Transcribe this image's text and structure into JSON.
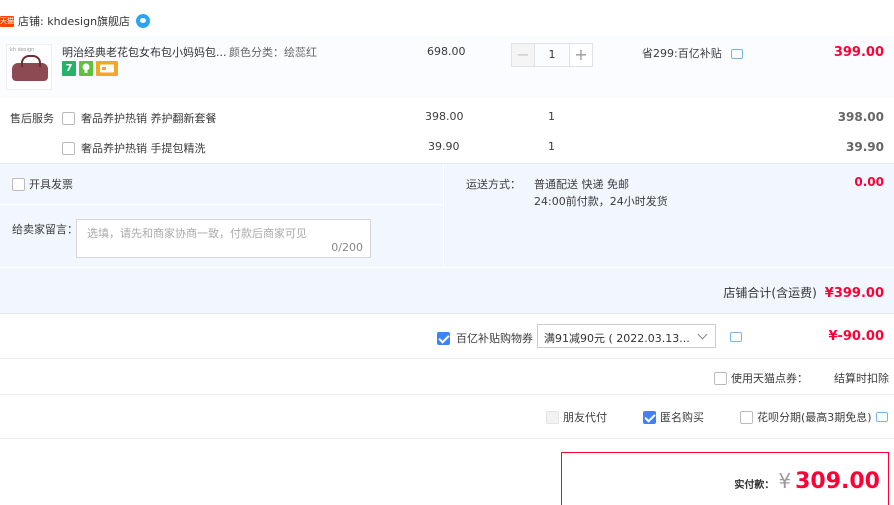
{
  "shop": {
    "tag": "天猫",
    "name": "店铺: khdesign旗舰店"
  },
  "item": {
    "thumb_brand": "kh design",
    "title": "明治经典老花包女布包小妈妈包...",
    "attr": "颜色分类：绘蕊红",
    "unit_price": "698.00",
    "quantity": "1",
    "saving": "省299:百亿补贴",
    "subtotal": "399.00",
    "badges": [
      "7",
      "bulb-icon",
      "card-icon"
    ]
  },
  "services": {
    "label": "售后服务",
    "items": [
      {
        "name": "奢品养护热销 养护翻新套餐",
        "price": "398.00",
        "qty": "1",
        "total": "398.00",
        "checked": false
      },
      {
        "name": "奢品养护热销 手提包精洗",
        "price": "39.90",
        "qty": "1",
        "total": "39.90",
        "checked": false
      }
    ]
  },
  "invoice": {
    "label": "开具发票",
    "checked": false
  },
  "shipping": {
    "label": "运送方式：",
    "method": "普通配送 快递 免邮",
    "detail": "24:00前付款，24小时发货",
    "fee": "0.00"
  },
  "memo": {
    "label": "给卖家留言：",
    "placeholder": "选填，请先和商家协商一致，付款后商家可见",
    "counter": "0/200"
  },
  "shop_total": {
    "label": "店铺合计(含运费)",
    "value": "¥399.00"
  },
  "coupon": {
    "label": "百亿补贴购物券",
    "checked": true,
    "selected": "满91减90元 ( 2022.03.13...",
    "discount": "¥-90.00"
  },
  "tmall_points": {
    "label": "使用天猫点券：",
    "note": "结算时扣除",
    "checked": false
  },
  "options": [
    {
      "label": "朋友代付",
      "checked": false,
      "disabled": true
    },
    {
      "label": "匿名购买",
      "checked": true,
      "disabled": false
    },
    {
      "label": "花呗分期(最高3期免息)",
      "checked": false,
      "disabled": false
    }
  ],
  "payment": {
    "label": "实付款：",
    "currency": "¥",
    "amount": "309.00"
  },
  "colors": {
    "accent_red": "#ff0036",
    "checkbox_blue": "#3e82f7",
    "panel_blue": "#f2f7ff"
  }
}
